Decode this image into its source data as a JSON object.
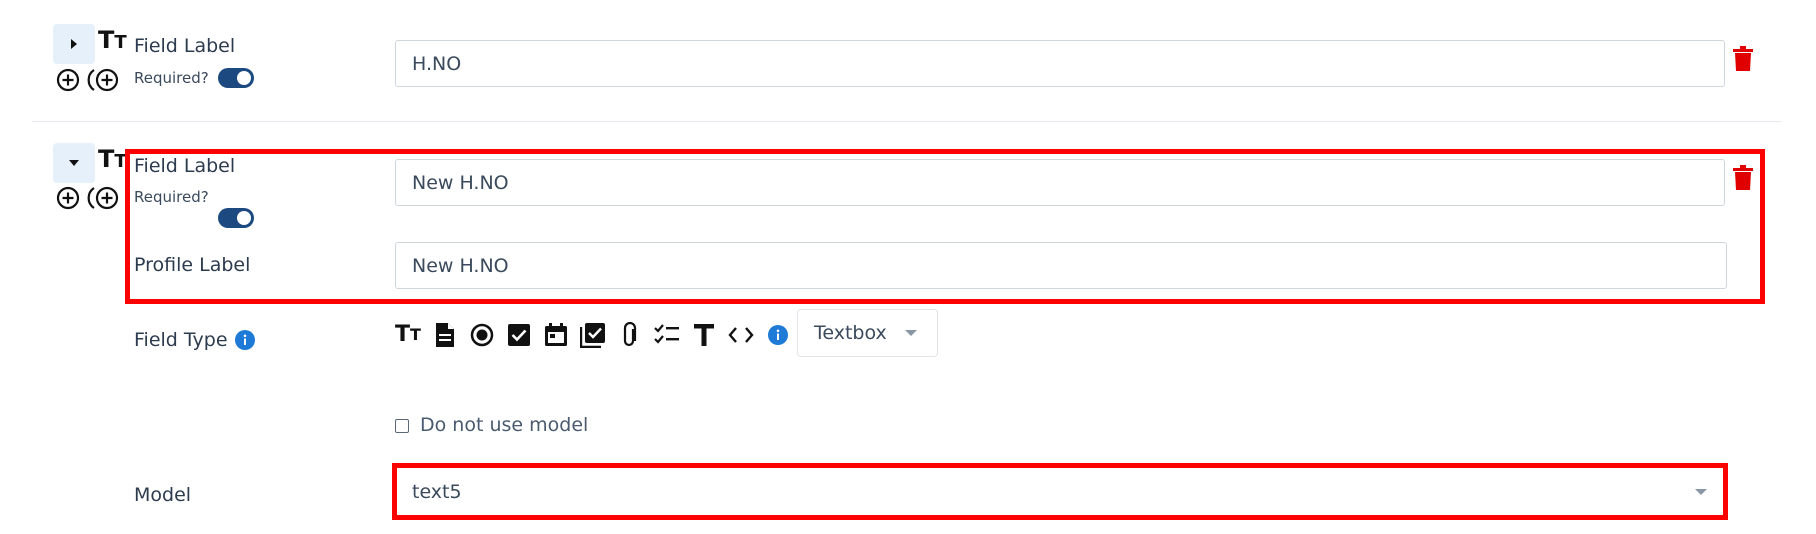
{
  "colors": {
    "accent": "#1c4a80",
    "danger": "#e00000",
    "info": "#1d7ad6",
    "highlight": "#ff0000",
    "toggle_bg": "#e6f0fa"
  },
  "row1": {
    "field_label": "Field Label",
    "required_label": "Required?",
    "field_value": "H.NO",
    "required_on": true
  },
  "row2": {
    "field_label": "Field Label",
    "required_label": "Required?",
    "field_value": "New H.NO",
    "required_on": true,
    "profile_label": "Profile Label",
    "profile_value": "New H.NO",
    "field_type_label": "Field Type",
    "field_type_icons": [
      "text-size-icon",
      "document-icon",
      "radio-icon",
      "checkbox-icon",
      "calendar-icon",
      "multi-checkbox-icon",
      "paperclip-icon",
      "checklist-icon",
      "text-icon",
      "code-icon"
    ],
    "field_type_selected": "Textbox",
    "do_not_use_model_label": "Do not use model",
    "do_not_use_model_checked": false,
    "model_label": "Model",
    "model_value": "text5"
  }
}
